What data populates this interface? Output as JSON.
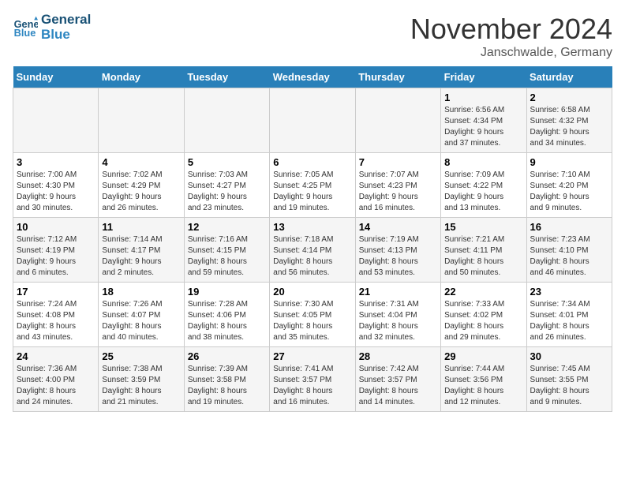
{
  "logo": {
    "line1": "General",
    "line2": "Blue"
  },
  "title": "November 2024",
  "subtitle": "Janschwalde, Germany",
  "days_header": [
    "Sunday",
    "Monday",
    "Tuesday",
    "Wednesday",
    "Thursday",
    "Friday",
    "Saturday"
  ],
  "weeks": [
    [
      {
        "day": "",
        "info": ""
      },
      {
        "day": "",
        "info": ""
      },
      {
        "day": "",
        "info": ""
      },
      {
        "day": "",
        "info": ""
      },
      {
        "day": "",
        "info": ""
      },
      {
        "day": "1",
        "info": "Sunrise: 6:56 AM\nSunset: 4:34 PM\nDaylight: 9 hours\nand 37 minutes."
      },
      {
        "day": "2",
        "info": "Sunrise: 6:58 AM\nSunset: 4:32 PM\nDaylight: 9 hours\nand 34 minutes."
      }
    ],
    [
      {
        "day": "3",
        "info": "Sunrise: 7:00 AM\nSunset: 4:30 PM\nDaylight: 9 hours\nand 30 minutes."
      },
      {
        "day": "4",
        "info": "Sunrise: 7:02 AM\nSunset: 4:29 PM\nDaylight: 9 hours\nand 26 minutes."
      },
      {
        "day": "5",
        "info": "Sunrise: 7:03 AM\nSunset: 4:27 PM\nDaylight: 9 hours\nand 23 minutes."
      },
      {
        "day": "6",
        "info": "Sunrise: 7:05 AM\nSunset: 4:25 PM\nDaylight: 9 hours\nand 19 minutes."
      },
      {
        "day": "7",
        "info": "Sunrise: 7:07 AM\nSunset: 4:23 PM\nDaylight: 9 hours\nand 16 minutes."
      },
      {
        "day": "8",
        "info": "Sunrise: 7:09 AM\nSunset: 4:22 PM\nDaylight: 9 hours\nand 13 minutes."
      },
      {
        "day": "9",
        "info": "Sunrise: 7:10 AM\nSunset: 4:20 PM\nDaylight: 9 hours\nand 9 minutes."
      }
    ],
    [
      {
        "day": "10",
        "info": "Sunrise: 7:12 AM\nSunset: 4:19 PM\nDaylight: 9 hours\nand 6 minutes."
      },
      {
        "day": "11",
        "info": "Sunrise: 7:14 AM\nSunset: 4:17 PM\nDaylight: 9 hours\nand 2 minutes."
      },
      {
        "day": "12",
        "info": "Sunrise: 7:16 AM\nSunset: 4:15 PM\nDaylight: 8 hours\nand 59 minutes."
      },
      {
        "day": "13",
        "info": "Sunrise: 7:18 AM\nSunset: 4:14 PM\nDaylight: 8 hours\nand 56 minutes."
      },
      {
        "day": "14",
        "info": "Sunrise: 7:19 AM\nSunset: 4:13 PM\nDaylight: 8 hours\nand 53 minutes."
      },
      {
        "day": "15",
        "info": "Sunrise: 7:21 AM\nSunset: 4:11 PM\nDaylight: 8 hours\nand 50 minutes."
      },
      {
        "day": "16",
        "info": "Sunrise: 7:23 AM\nSunset: 4:10 PM\nDaylight: 8 hours\nand 46 minutes."
      }
    ],
    [
      {
        "day": "17",
        "info": "Sunrise: 7:24 AM\nSunset: 4:08 PM\nDaylight: 8 hours\nand 43 minutes."
      },
      {
        "day": "18",
        "info": "Sunrise: 7:26 AM\nSunset: 4:07 PM\nDaylight: 8 hours\nand 40 minutes."
      },
      {
        "day": "19",
        "info": "Sunrise: 7:28 AM\nSunset: 4:06 PM\nDaylight: 8 hours\nand 38 minutes."
      },
      {
        "day": "20",
        "info": "Sunrise: 7:30 AM\nSunset: 4:05 PM\nDaylight: 8 hours\nand 35 minutes."
      },
      {
        "day": "21",
        "info": "Sunrise: 7:31 AM\nSunset: 4:04 PM\nDaylight: 8 hours\nand 32 minutes."
      },
      {
        "day": "22",
        "info": "Sunrise: 7:33 AM\nSunset: 4:02 PM\nDaylight: 8 hours\nand 29 minutes."
      },
      {
        "day": "23",
        "info": "Sunrise: 7:34 AM\nSunset: 4:01 PM\nDaylight: 8 hours\nand 26 minutes."
      }
    ],
    [
      {
        "day": "24",
        "info": "Sunrise: 7:36 AM\nSunset: 4:00 PM\nDaylight: 8 hours\nand 24 minutes."
      },
      {
        "day": "25",
        "info": "Sunrise: 7:38 AM\nSunset: 3:59 PM\nDaylight: 8 hours\nand 21 minutes."
      },
      {
        "day": "26",
        "info": "Sunrise: 7:39 AM\nSunset: 3:58 PM\nDaylight: 8 hours\nand 19 minutes."
      },
      {
        "day": "27",
        "info": "Sunrise: 7:41 AM\nSunset: 3:57 PM\nDaylight: 8 hours\nand 16 minutes."
      },
      {
        "day": "28",
        "info": "Sunrise: 7:42 AM\nSunset: 3:57 PM\nDaylight: 8 hours\nand 14 minutes."
      },
      {
        "day": "29",
        "info": "Sunrise: 7:44 AM\nSunset: 3:56 PM\nDaylight: 8 hours\nand 12 minutes."
      },
      {
        "day": "30",
        "info": "Sunrise: 7:45 AM\nSunset: 3:55 PM\nDaylight: 8 hours\nand 9 minutes."
      }
    ]
  ]
}
